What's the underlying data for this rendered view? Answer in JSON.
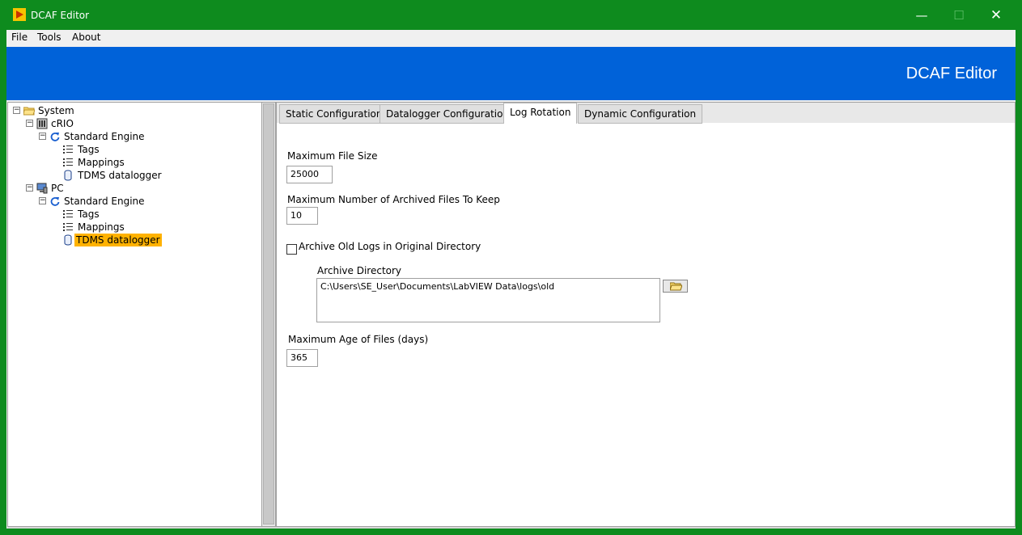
{
  "window": {
    "title": "DCAF Editor",
    "controls": {
      "minimize": "—",
      "maximize": "☐",
      "close": "✕"
    }
  },
  "menu": {
    "file": "File",
    "tools": "Tools",
    "about": "About"
  },
  "banner": {
    "title": "DCAF Editor"
  },
  "tree": {
    "system": "System",
    "crio": "cRIO",
    "crio_engine": "Standard Engine",
    "crio_tags": "Tags",
    "crio_mappings": "Mappings",
    "crio_tdms": "TDMS datalogger",
    "pc": "PC",
    "pc_engine": "Standard Engine",
    "pc_tags": "Tags",
    "pc_mappings": "Mappings",
    "pc_tdms": "TDMS datalogger",
    "selected": "pc_tdms",
    "expander_symbol": "−"
  },
  "tabs": {
    "static": "Static Configuration",
    "datalogger": "Datalogger Configuration",
    "log_rotation": "Log Rotation",
    "dynamic": "Dynamic Configuration",
    "active": "log_rotation"
  },
  "log_rotation": {
    "max_file_size_label": "Maximum File Size",
    "max_file_size_value": "25000",
    "max_archived_label": "Maximum Number of Archived Files To Keep",
    "max_archived_value": "10",
    "archive_original_label": "Archive Old Logs in Original Directory",
    "archive_original_checked": false,
    "archive_dir_label": "Archive Directory",
    "archive_dir_value": "C:\\Users\\SE_User\\Documents\\LabVIEW Data\\logs\\old",
    "max_age_label": "Maximum Age of Files (days)",
    "max_age_value": "365"
  },
  "colors": {
    "frame": "#0e8b1e",
    "banner": "#0062d9",
    "selection": "#ffb200"
  },
  "icons": {
    "app": "labview-run-icon",
    "folder": "folder-open-icon",
    "target_crio": "crio-target-icon",
    "target_pc": "pc-target-icon",
    "engine": "engine-refresh-icon",
    "tags": "tag-list-icon",
    "mappings": "mapping-list-icon",
    "datalogger": "database-cylinder-icon",
    "browse": "folder-browse-icon"
  }
}
